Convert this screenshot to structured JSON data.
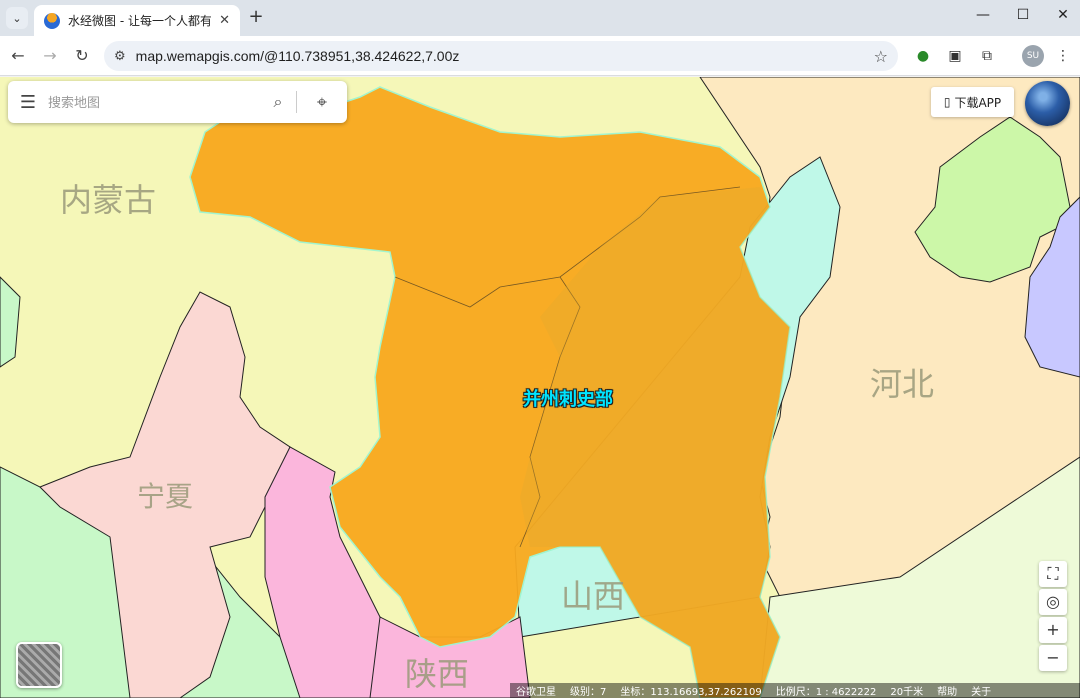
{
  "browser": {
    "tab_title": "水经微图 - 让每一个人都有自己",
    "url": "map.wemapgis.com/@110.738951,38.424622,7.00z",
    "profile_initials": "SU"
  },
  "search": {
    "placeholder": "搜索地图"
  },
  "app_button": "下载APP",
  "regions": {
    "neimenggu": "内蒙古",
    "hebei": "河北",
    "ningxia": "宁夏",
    "shanxi": "山西",
    "shaanxi": "陕西"
  },
  "focus_label": "并州刺史部",
  "controls": {
    "zoom_in": "+",
    "zoom_out": "−"
  },
  "status": {
    "layer": "谷歌卫星",
    "level_label": "级别：",
    "level": "7",
    "coord_label": "坐标：",
    "coord": "113.16693,37.262109",
    "scale_label": "比例尺：",
    "scale": "1 : 4622222",
    "distance": "20千米",
    "help": "帮助",
    "about": "关于"
  },
  "colors": {
    "neimenggu": "#f5f7b8",
    "hebei": "#fde9c0",
    "beijing": "#ccf7a8",
    "tianjin": "#c8c8ff",
    "ningxia": "#fbd8d3",
    "shanxi_province": "#bff8e8",
    "shaanxi": "#fbb6dc",
    "gansu": "#c8f8c8",
    "henan": "#eefad8",
    "bingzhou": "#f9a91e"
  }
}
